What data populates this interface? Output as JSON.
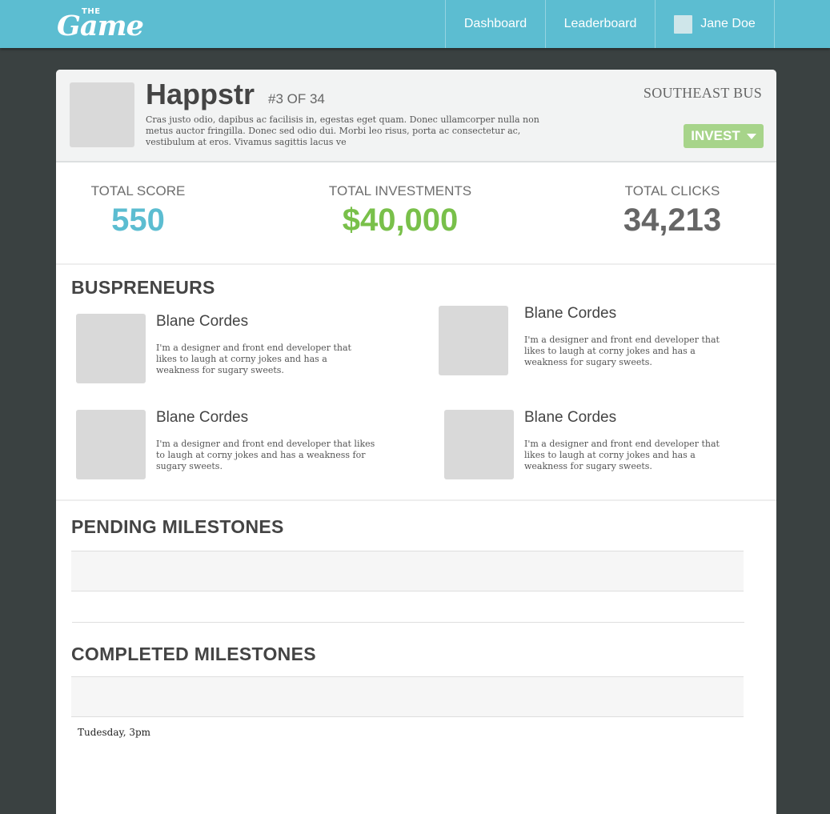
{
  "nav": {
    "logo_small": "THE",
    "logo_main": "Game",
    "dashboard": "Dashboard",
    "leaderboard": "Leaderboard",
    "user_name": "Jane Doe"
  },
  "company": {
    "name": "Happstr",
    "rank": "#3 OF 34",
    "description": "Cras justo odio, dapibus ac facilisis in, egestas eget quam. Donec ullamcorper nulla non metus auctor fringilla. Donec sed odio dui. Morbi leo risus, porta ac consectetur ac, vestibulum at eros. Vivamus sagittis lacus ve",
    "route": "SOUTHEAST BUS",
    "invest_label": "INVEST"
  },
  "stats": {
    "score_label": "TOTAL SCORE",
    "score_value": "550",
    "investments_label": "TOTAL INVESTMENTS",
    "investments_value": "$40,000",
    "clicks_label": "TOTAL CLICKS",
    "clicks_value": "34,213"
  },
  "buspreneurs": {
    "title": "BUSPRENEURS",
    "people": [
      {
        "name": "Blane Cordes",
        "bio": "I'm a designer and front end developer that likes to laugh at corny jokes and has a weakness for sugary sweets."
      },
      {
        "name": "Blane Cordes",
        "bio": "I'm a designer and front end developer that likes to laugh at corny jokes and has a weakness for sugary sweets."
      },
      {
        "name": "Blane Cordes",
        "bio": "I'm a designer and front end developer that likes to laugh at corny jokes and has a weakness for sugary sweets."
      },
      {
        "name": "Blane Cordes",
        "bio": "I'm a designer and front end developer that likes to laugh at corny jokes and has a weakness for sugary sweets."
      }
    ]
  },
  "pending": {
    "title": "PENDING MILESTONES"
  },
  "completed": {
    "title": "COMPLETED MILESTONES",
    "timestamp": "Tudesday, 3pm"
  },
  "colors": {
    "nav_bg": "#5cbdd1",
    "page_bg": "#3a4141",
    "score": "#5cbdd1",
    "investments": "#79c04a",
    "invest_button": "#a7d48a"
  }
}
